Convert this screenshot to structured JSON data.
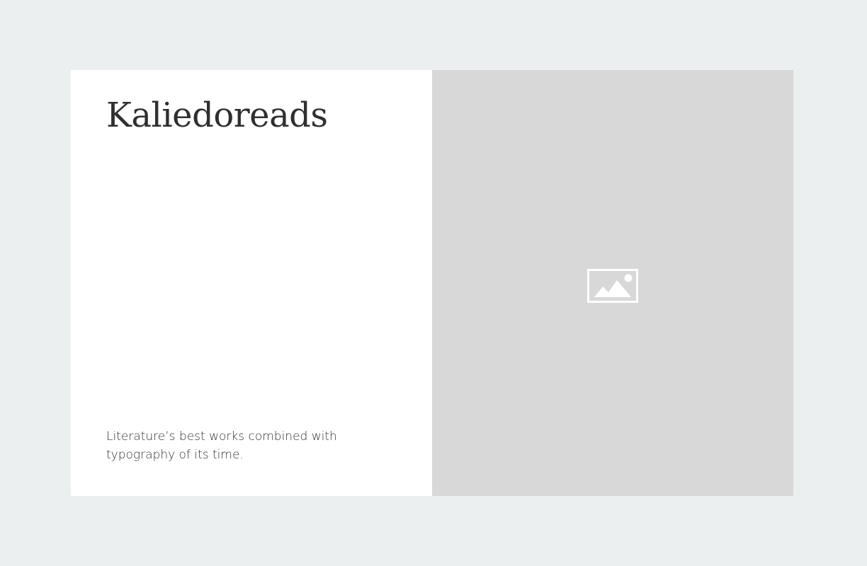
{
  "hero": {
    "title": "Kaliedoreads",
    "tagline": "Literature’s best works combined with typography of its time.",
    "image_icon": "image-placeholder-icon"
  },
  "colors": {
    "page_background": "#ebeff0",
    "card_background": "#ffffff",
    "image_background": "#d8d8d8",
    "title_color": "#2f2f2f",
    "text_color": "#333333",
    "icon_color": "#ffffff"
  }
}
